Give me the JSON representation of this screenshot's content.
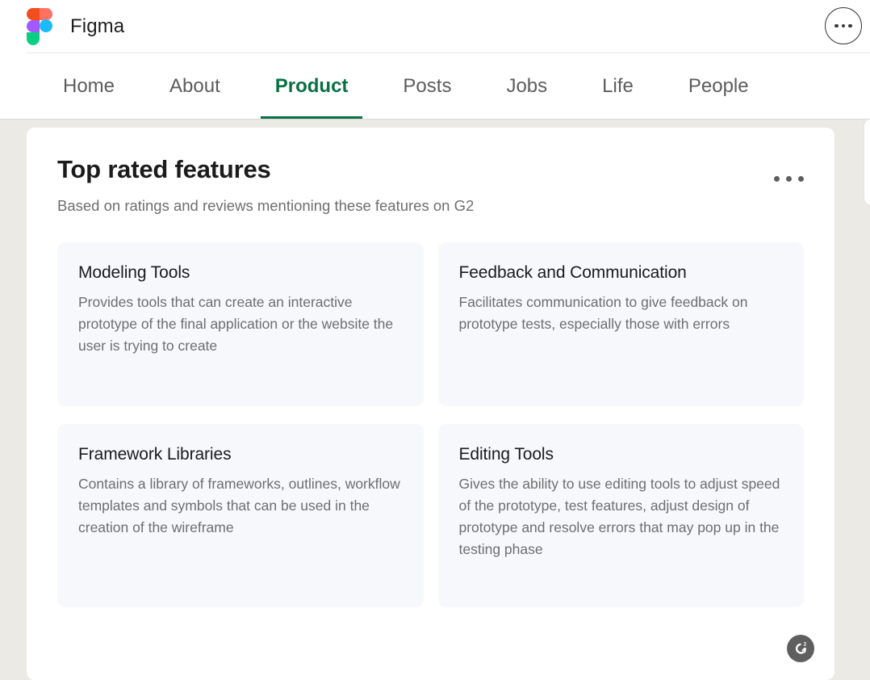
{
  "header": {
    "brand_name": "Figma",
    "logo_icon": "figma-logo-icon",
    "menu_button_icon": "more-horizontal-icon",
    "menu_button_label": "More options"
  },
  "nav": {
    "tabs": [
      {
        "label": "Home",
        "active": false
      },
      {
        "label": "About",
        "active": false
      },
      {
        "label": "Product",
        "active": true
      },
      {
        "label": "Posts",
        "active": false
      },
      {
        "label": "Jobs",
        "active": false
      },
      {
        "label": "Life",
        "active": false
      },
      {
        "label": "People",
        "active": false
      }
    ],
    "active_tab": "Product"
  },
  "main": {
    "title": "Top rated features",
    "subtitle": "Based on ratings and reviews mentioning these features on G2",
    "menu_icon": "more-horizontal-icon",
    "features": [
      {
        "title": "Modeling Tools",
        "description": "Provides tools that can create an interactive prototype of the final application or the website the user is trying to create"
      },
      {
        "title": "Feedback and Communication",
        "description": "Facilitates communication to give feedback on prototype tests, especially those with errors"
      },
      {
        "title": "Framework Libraries",
        "description": "Contains a library of frameworks, outlines, workflow templates and symbols that can be used in the creation of the wireframe"
      },
      {
        "title": "Editing Tools",
        "description": "Gives the ability to use editing tools to adjust speed of the prototype, test features, adjust design of prototype and resolve errors that may pop up in the testing phase"
      }
    ],
    "attribution_badge": {
      "icon": "g2-logo-icon",
      "label": "G2"
    }
  },
  "colors": {
    "accent_green": "#0A7044",
    "page_background": "#ECEAE4",
    "card_background": "#FFFFFF",
    "feature_card_background": "#F7F8FC",
    "title_text": "#1B1B1B",
    "muted_text": "#6E6E6E",
    "badge_background": "#5F5F5F"
  }
}
